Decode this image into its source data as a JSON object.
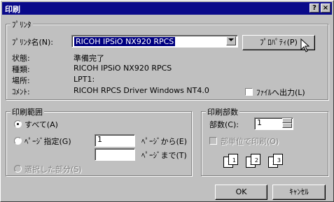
{
  "window": {
    "title": "印刷",
    "help_btn": "?",
    "close_btn": "×"
  },
  "printer": {
    "group_title": "ﾌﾟﾘﾝﾀ",
    "name_label": "ﾌﾟﾘﾝﾀ名(N):",
    "name_value": "RICOH IPSiO NX920 RPCS",
    "properties_label": "ﾌﾟﾛﾊﾟﾃｨ(P)",
    "status_label": "状態:",
    "status_value": "準備完了",
    "type_label": "種類:",
    "type_value": "RICOH IPSiO NX920 RPCS",
    "where_label": "場所:",
    "where_value": "LPT1:",
    "comment_label": "ｺﾒﾝﾄ:",
    "comment_value": "RICOH RPCS Driver Windows NT4.0",
    "print_to_file_label": "ﾌｧｲﾙへ出力(L)"
  },
  "range": {
    "group_title": "印刷範囲",
    "all_label": "すべて(A)",
    "pages_label": "ﾍﾟｰｼﾞ指定(G)",
    "from_value": "1",
    "from_label": "ﾍﾟｰｼﾞから(E)",
    "to_value": "",
    "to_label": "ﾍﾟｰｼﾞまで(T)",
    "selection_label": "選択した部分(S)"
  },
  "copies": {
    "group_title": "印刷部数",
    "count_label": "部数(C):",
    "count_value": "1",
    "collate_label": "部単位で印刷(O)",
    "collate_pages": [
      "1",
      "1",
      "2",
      "2",
      "3",
      "3"
    ]
  },
  "buttons": {
    "ok": "OK",
    "cancel": "ｷｬﾝｾﾙ"
  }
}
